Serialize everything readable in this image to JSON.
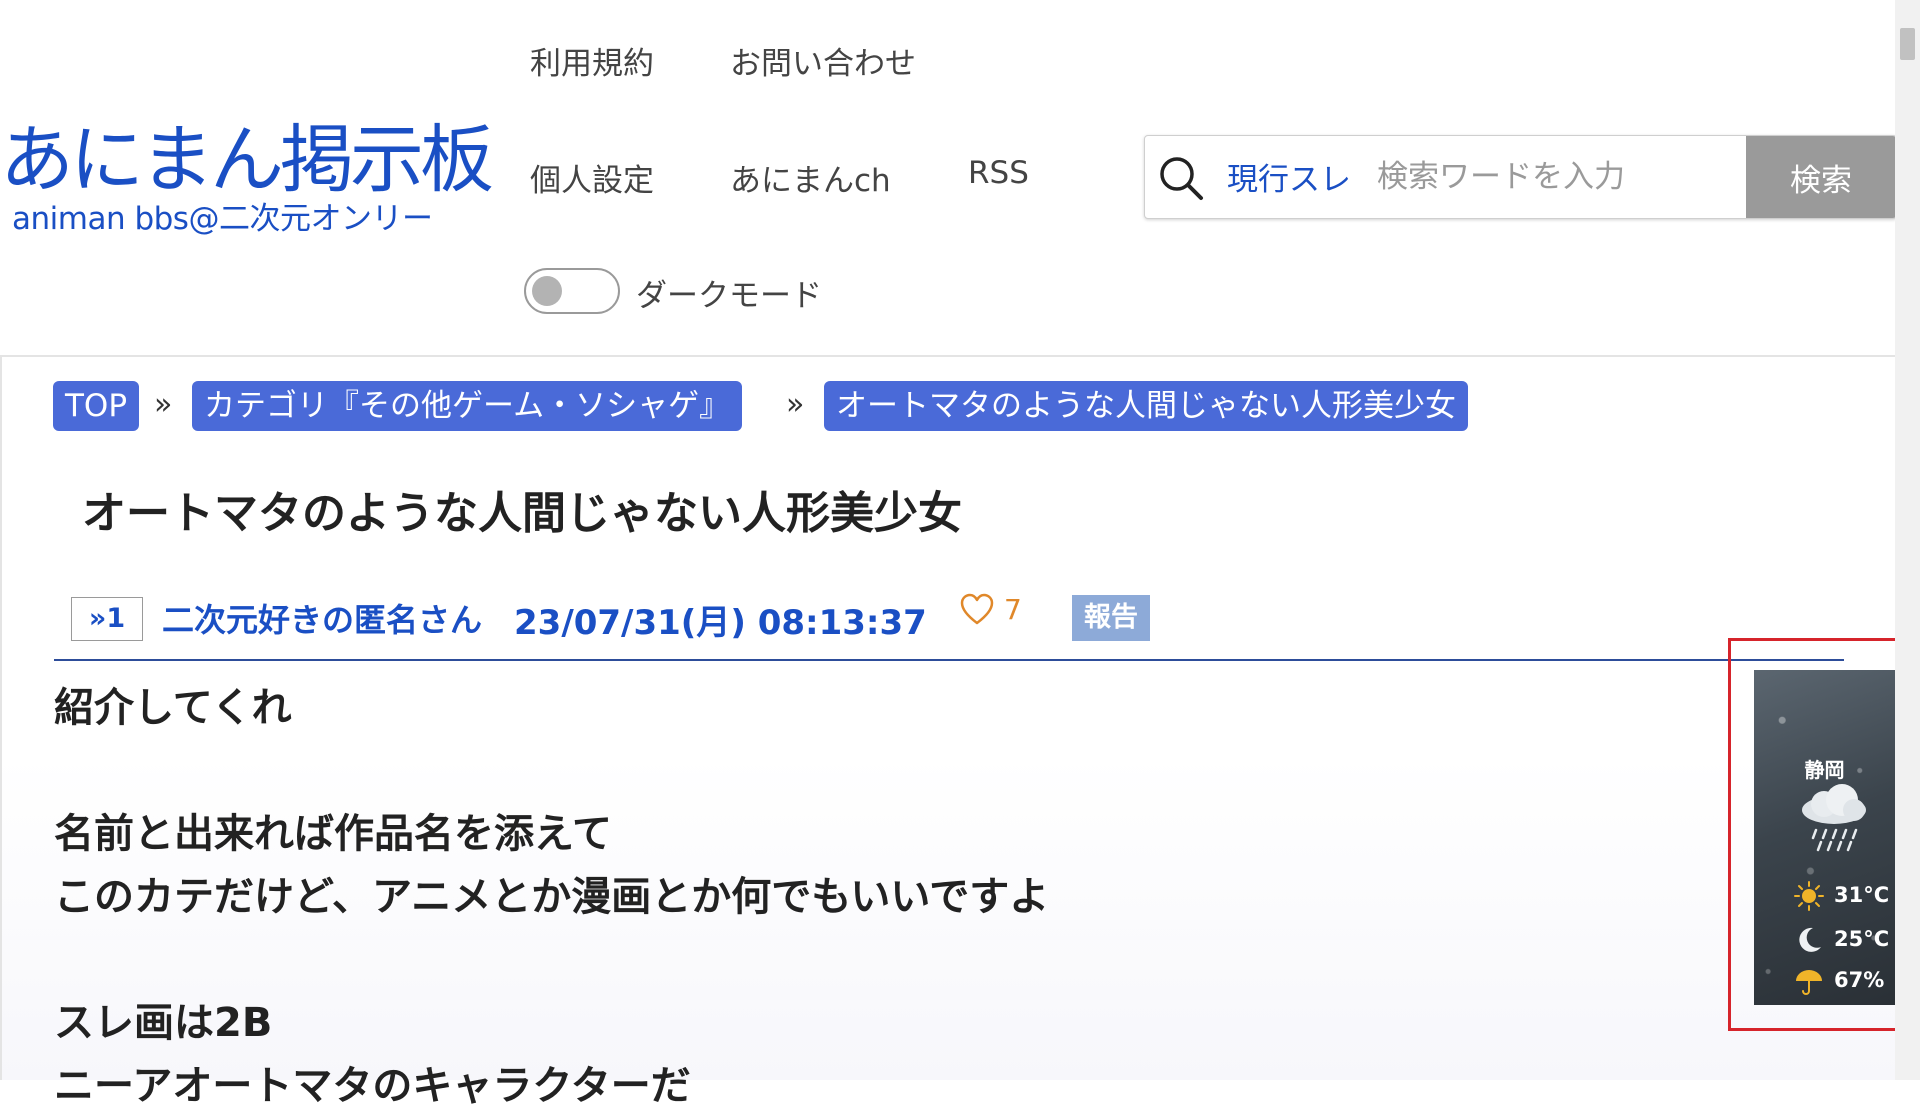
{
  "header": {
    "logo_main": "あにまん掲示板",
    "logo_sub": "animan bbs@二次元オンリー",
    "nav": {
      "terms": "利用規約",
      "contact": "お問い合わせ",
      "settings": "個人設定",
      "animanch": "あにまんch",
      "rss": "RSS"
    },
    "search": {
      "scope": "現行スレ",
      "placeholder": "検索ワードを入力",
      "button": "検索"
    },
    "dark_mode": {
      "label": "ダークモード",
      "enabled": false
    }
  },
  "breadcrumb": {
    "items": [
      "TOP",
      "カテゴリ『その他ゲーム・ソシャゲ』",
      "オートマタのような人間じゃない人形美少女"
    ],
    "separator": "»"
  },
  "thread": {
    "title": "オートマタのような人間じゃない人形美少女"
  },
  "post": {
    "number": "»1",
    "author": "二次元好きの匿名さん",
    "date": "23/07/31(月) 08:13:37",
    "likes": "7",
    "report": "報告",
    "body": "紹介してくれ\n\n名前と出来れば作品名を添えて\nこのカテだけど、アニメとか漫画とか何でもいいですよ\n\nスレ画は2B\nニーアオートマタのキャラクターだ"
  },
  "weather": {
    "city": "静岡",
    "high": "31°C",
    "low": "25°C",
    "rain_chance": "67%"
  },
  "colors": {
    "brand_blue": "#1a4fc4",
    "crumb_bg": "#4a6ad8",
    "report_bg": "#8daad8",
    "like_orange": "#e0882a",
    "highlight_red": "#d6242b"
  }
}
